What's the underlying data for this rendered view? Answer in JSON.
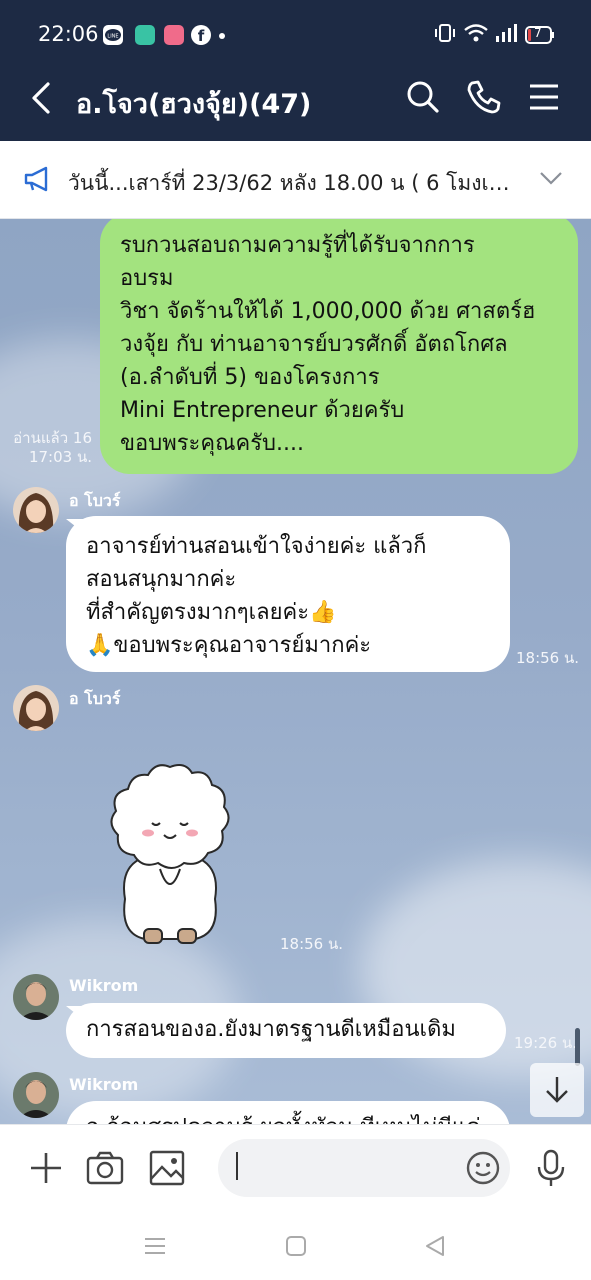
{
  "status_bar": {
    "time": "22:06",
    "battery": "7"
  },
  "header": {
    "title": "อ.โจว(ฮวงจุ้ย)(47)"
  },
  "announcement": {
    "text": "วันนี้...เสาร์ที่ 23/3/62  หลัง 18.00 น ( 6 โมงเย็..."
  },
  "messages": [
    {
      "direction": "outgoing",
      "lines": [
        "รบกวนสอบถามความรู้ที่ได้รับจากการ",
        "อบรม",
        "วิชา จัดร้านให้ได้ 1,000,000 ด้วย ศาสตร์ฮ",
        "วงจุ้ย กับ ท่านอาจารย์บวรศักดิ์ อัตถโกศล",
        "(อ.ลำดับที่ 5) ของโครงการ",
        "Mini Entrepreneur ด้วยครับ",
        "ขอบพระคุณครับ...."
      ],
      "read": "อ่านแล้ว 16",
      "time": "17:03 น."
    },
    {
      "direction": "incoming",
      "sender": "อ โบวร์",
      "lines": [
        "อาจารย์ท่านสอนเข้าใจง่ายค่ะ แล้วก็",
        "สอนสนุกมากค่ะ",
        "ที่สำคัญตรงมากๆเลยค่ะ👍",
        "🙏ขอบพระคุณอาจารย์มากค่ะ"
      ],
      "time": "18:56 น."
    },
    {
      "direction": "incoming",
      "sender": "อ โบวร์",
      "sticker": "sheep-bow-sticker",
      "time": "18:56 น."
    },
    {
      "direction": "incoming",
      "sender": "Wikrom",
      "lines": [
        "การสอนของอ.ยังมาตรฐานดีเหมือนเดิม"
      ],
      "time": "19:26 น."
    },
    {
      "direction": "incoming",
      "sender": "Wikrom",
      "lines": [
        "อ.ก้อนสรุปความรู้ ผลทั้งหัวน  ทีเหนไม่มีแค่ปะ"
      ],
      "time": ""
    }
  ],
  "input": {
    "placeholder": ""
  },
  "colors": {
    "header_bg": "#1d2a44",
    "outgoing_bubble": "#a3e37f",
    "incoming_bubble": "#ffffff",
    "chat_bg": "#97abc9"
  }
}
